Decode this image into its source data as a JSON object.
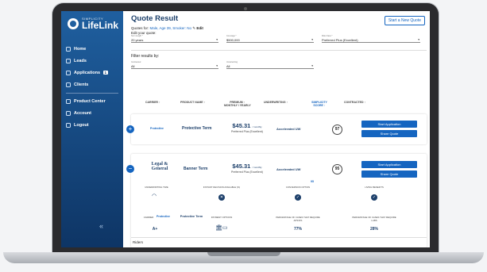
{
  "app": {
    "logo_sub": "SIMPLICITY",
    "logo_main": "LifeLink"
  },
  "sidebar": {
    "items": [
      {
        "label": "Home",
        "icon": "home-icon"
      },
      {
        "label": "Leads",
        "icon": "leads-icon"
      },
      {
        "label": "Applications",
        "icon": "applications-icon",
        "badge": "1"
      },
      {
        "label": "Clients",
        "icon": "clients-icon"
      },
      {
        "label": "Product Center",
        "icon": "product-center-icon"
      },
      {
        "label": "Account",
        "icon": "account-icon"
      },
      {
        "label": "Logout",
        "icon": "logout-icon"
      }
    ],
    "collapse_glyph": "«"
  },
  "header": {
    "title": "Quote Result",
    "new_quote": "Start a New Quote",
    "quotes_for_prefix": "Quotes for:",
    "quotes_for_value": "Male, Age 39, Smoker: No",
    "edit": "Edit",
    "edit_your_quote": "Edit your quote:"
  },
  "quote_fields": [
    {
      "label": "Term length *",
      "value": "20 years"
    },
    {
      "label": "Coverage *",
      "value": "$500,000"
    },
    {
      "label": "Risk Class *",
      "value": "Preferred Plus (Excellent)"
    }
  ],
  "filter": {
    "title": "Filter results by:",
    "fields": [
      {
        "label": "Contracted",
        "value": "All"
      },
      {
        "label": "Underwriting",
        "value": "All"
      }
    ]
  },
  "columns": [
    "CARRIER",
    "PRODUCT NAME",
    "PREMIUM",
    "UNDERWRITING",
    "SIMPLICITY SCORE",
    "CONTRACTED"
  ],
  "premium_sub": "MONTHLY / YEARLY",
  "results": [
    {
      "carrier": "Protective",
      "product": "Protective Term",
      "price": "$45.31",
      "per": "/ monthly",
      "plan": "Preferred Plus (Excellent)",
      "uw": "Accelerated UW",
      "score": "97"
    },
    {
      "carrier": "Legal & General",
      "product": "Banner Term",
      "price": "$45.31",
      "per": "/ monthly",
      "plan": "Preferred Plus (Excellent)",
      "uw": "Accelerated UW",
      "score": "95"
    }
  ],
  "buttons": {
    "start": "Start Application",
    "share": "Share Quote"
  },
  "details": {
    "row1": [
      {
        "label": "UNDERWRITING TIME"
      },
      {
        "label": "INSTANT DECISION AVAILABLE (%)"
      },
      {
        "label": "CONVERSION OPTION"
      },
      {
        "label": "LIVING BENEFITS"
      }
    ],
    "row2": [
      {
        "label": "CARRIER",
        "value": "A+"
      },
      {
        "label": "",
        "value": "Protective Term"
      },
      {
        "label": "PAYMENT OPTIONS"
      },
      {
        "label": "PERCENTAGE OF CASES THAT REQUIRE APS/IFS",
        "value": "77%"
      },
      {
        "label": "PERCENTAGE OF CASES THAT REQUIRE LABS",
        "value": "28%"
      }
    ],
    "marker": "95"
  },
  "riders_label": "Riders",
  "colors": {
    "accent": "#1565c0",
    "sidebar": "#1f5f9f"
  }
}
